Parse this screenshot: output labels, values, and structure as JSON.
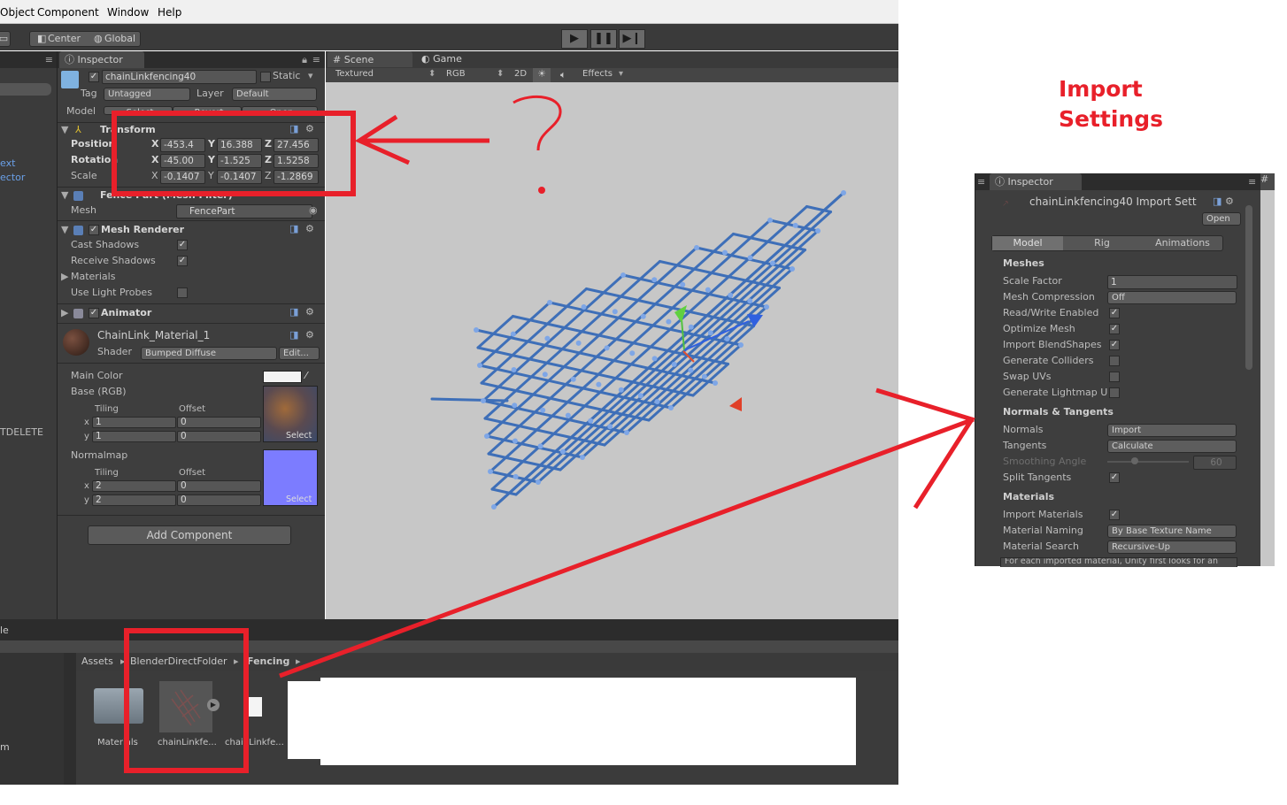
{
  "menubar": {
    "items": [
      "Object",
      "Component",
      "Window",
      "Help"
    ]
  },
  "toolbar": {
    "center_label": "Center",
    "global_label": "Global"
  },
  "inspector": {
    "tab_label": "Inspector",
    "object_name": "chainLinkfencing40",
    "static_label": "Static",
    "tag_label": "Tag",
    "tag_value": "Untagged",
    "layer_label": "Layer",
    "layer_value": "Default",
    "model_label": "Model",
    "model_buttons": [
      "Select",
      "Revert",
      "Open"
    ],
    "transform": {
      "title": "Transform",
      "position": {
        "label": "Position",
        "x": "-453.4",
        "y": "16.388",
        "z": "27.456"
      },
      "rotation": {
        "label": "Rotation",
        "x": "-45.00",
        "y": "-1.525",
        "z": "1.5258"
      },
      "scale": {
        "label": "Scale",
        "x": "-0.1407",
        "y": "-0.1407",
        "z": "-1.2869"
      }
    },
    "mesh_filter": {
      "title": "Fence Part (Mesh Filter)",
      "mesh_label": "Mesh",
      "mesh_value": "FencePart"
    },
    "mesh_renderer": {
      "title": "Mesh Renderer",
      "cast_shadows": "Cast Shadows",
      "receive_shadows": "Receive Shadows",
      "materials": "Materials",
      "light_probes": "Use Light Probes"
    },
    "animator": {
      "title": "Animator"
    },
    "material": {
      "name": "ChainLink_Material_1",
      "shader_label": "Shader",
      "shader_value": "Bumped Diffuse",
      "edit_label": "Edit...",
      "main_color": "Main Color",
      "base": "Base (RGB)",
      "tiling": "Tiling",
      "offset": "Offset",
      "base_x_tiling": "1",
      "base_x_offset": "0",
      "base_y_tiling": "1",
      "base_y_offset": "0",
      "normalmap": "Normalmap",
      "normal_x_tiling": "2",
      "normal_x_offset": "0",
      "normal_y_tiling": "2",
      "normal_y_offset": "0",
      "select_label": "Select"
    },
    "add_component": "Add Component"
  },
  "left_panel": {
    "text1": "ext",
    "text2": "ector",
    "text3": "TDELETE"
  },
  "scene": {
    "tab_scene": "Scene",
    "tab_game": "Game",
    "textured": "Textured",
    "rgb": "RGB",
    "mode_2d": "2D",
    "effects": "Effects"
  },
  "project": {
    "left_label": "le",
    "left_label2": "m",
    "breadcrumb": [
      "Assets",
      "BlenderDirectFolder",
      "Fencing"
    ],
    "items": [
      "Materials",
      "chainLinkfe...",
      "chainLinkfe..."
    ]
  },
  "import_settings": {
    "annotation_line1": "Import",
    "annotation_line2": "Settings",
    "tab_label": "Inspector",
    "title": "chainLinkfencing40 Import Sett",
    "open_label": "Open",
    "tabs": [
      "Model",
      "Rig",
      "Animations"
    ],
    "meshes": "Meshes",
    "scale_factor_label": "Scale Factor",
    "scale_factor_value": "1",
    "mesh_compression_label": "Mesh Compression",
    "mesh_compression_value": "Off",
    "read_write": "Read/Write Enabled",
    "optimize_mesh": "Optimize Mesh",
    "import_blendshapes": "Import BlendShapes",
    "generate_colliders": "Generate Colliders",
    "swap_uvs": "Swap UVs",
    "generate_lightmap": "Generate Lightmap U",
    "normals_tangents": "Normals & Tangents",
    "normals_label": "Normals",
    "normals_value": "Import",
    "tangents_label": "Tangents",
    "tangents_value": "Calculate",
    "smoothing_label": "Smoothing Angle",
    "smoothing_value": "60",
    "split_tangents": "Split Tangents",
    "materials": "Materials",
    "import_materials": "Import Materials",
    "material_naming_label": "Material Naming",
    "material_naming_value": "By Base Texture Name",
    "material_search_label": "Material Search",
    "material_search_value": "Recursive-Up",
    "help_text": "For each imported material, Unity first looks for an"
  },
  "annotation": {
    "question_mark": "?"
  },
  "colors": {
    "annotation_red": "#e8202a",
    "panel": "#3e3e3e",
    "scene_bg": "#c7c7c7",
    "mesh_blue": "#3e6fb8"
  }
}
